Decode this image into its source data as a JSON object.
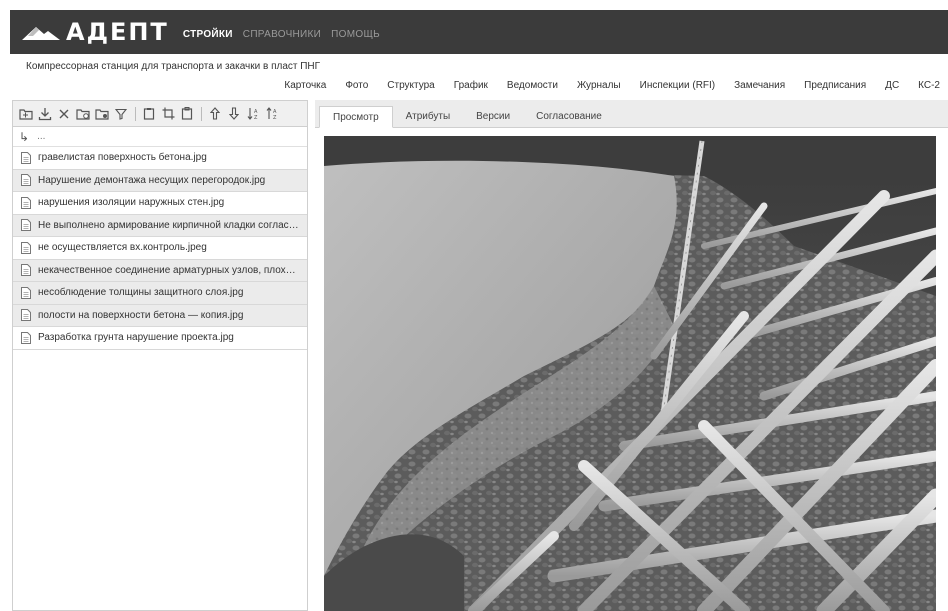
{
  "app": {
    "logo_text": "АДЕПТ",
    "topnav": [
      "СТРОЙКИ",
      "СПРАВОЧНИКИ",
      "ПОМОЩЬ"
    ]
  },
  "project": {
    "title": "Компрессорная станция для транспорта и закачки в пласт ПНГ"
  },
  "mainnav": [
    "Карточка",
    "Фото",
    "Структура",
    "График",
    "Ведомости",
    "Журналы",
    "Инспекции (RFI)",
    "Замечания",
    "Предписания",
    "ДС",
    "КС-2"
  ],
  "filepanel": {
    "up_label": "...",
    "files": [
      "гравелистая поверхность бетона.jpg",
      "Нарушение демонтажа несущих перегородок.jpg",
      "нарушения изоляции наружных стен.jpg",
      "Не выполнено армирование кирпичной кладки согласно проекту.jpg",
      "не осуществляется вх.контроль.jpeg",
      "некачественное соединение арматурных узлов, плохая вязка.jpg",
      "несоблюдение толщины защитного слоя.jpg",
      "полости на поверхности бетона — копия.jpg",
      "Разработка грунта нарушение проекта.jpg"
    ]
  },
  "tabs": [
    "Просмотр",
    "Атрибуты",
    "Версии",
    "Согласование"
  ],
  "colors": {
    "topbar": "#3b3b3b",
    "alt_row": "#ebebeb"
  }
}
